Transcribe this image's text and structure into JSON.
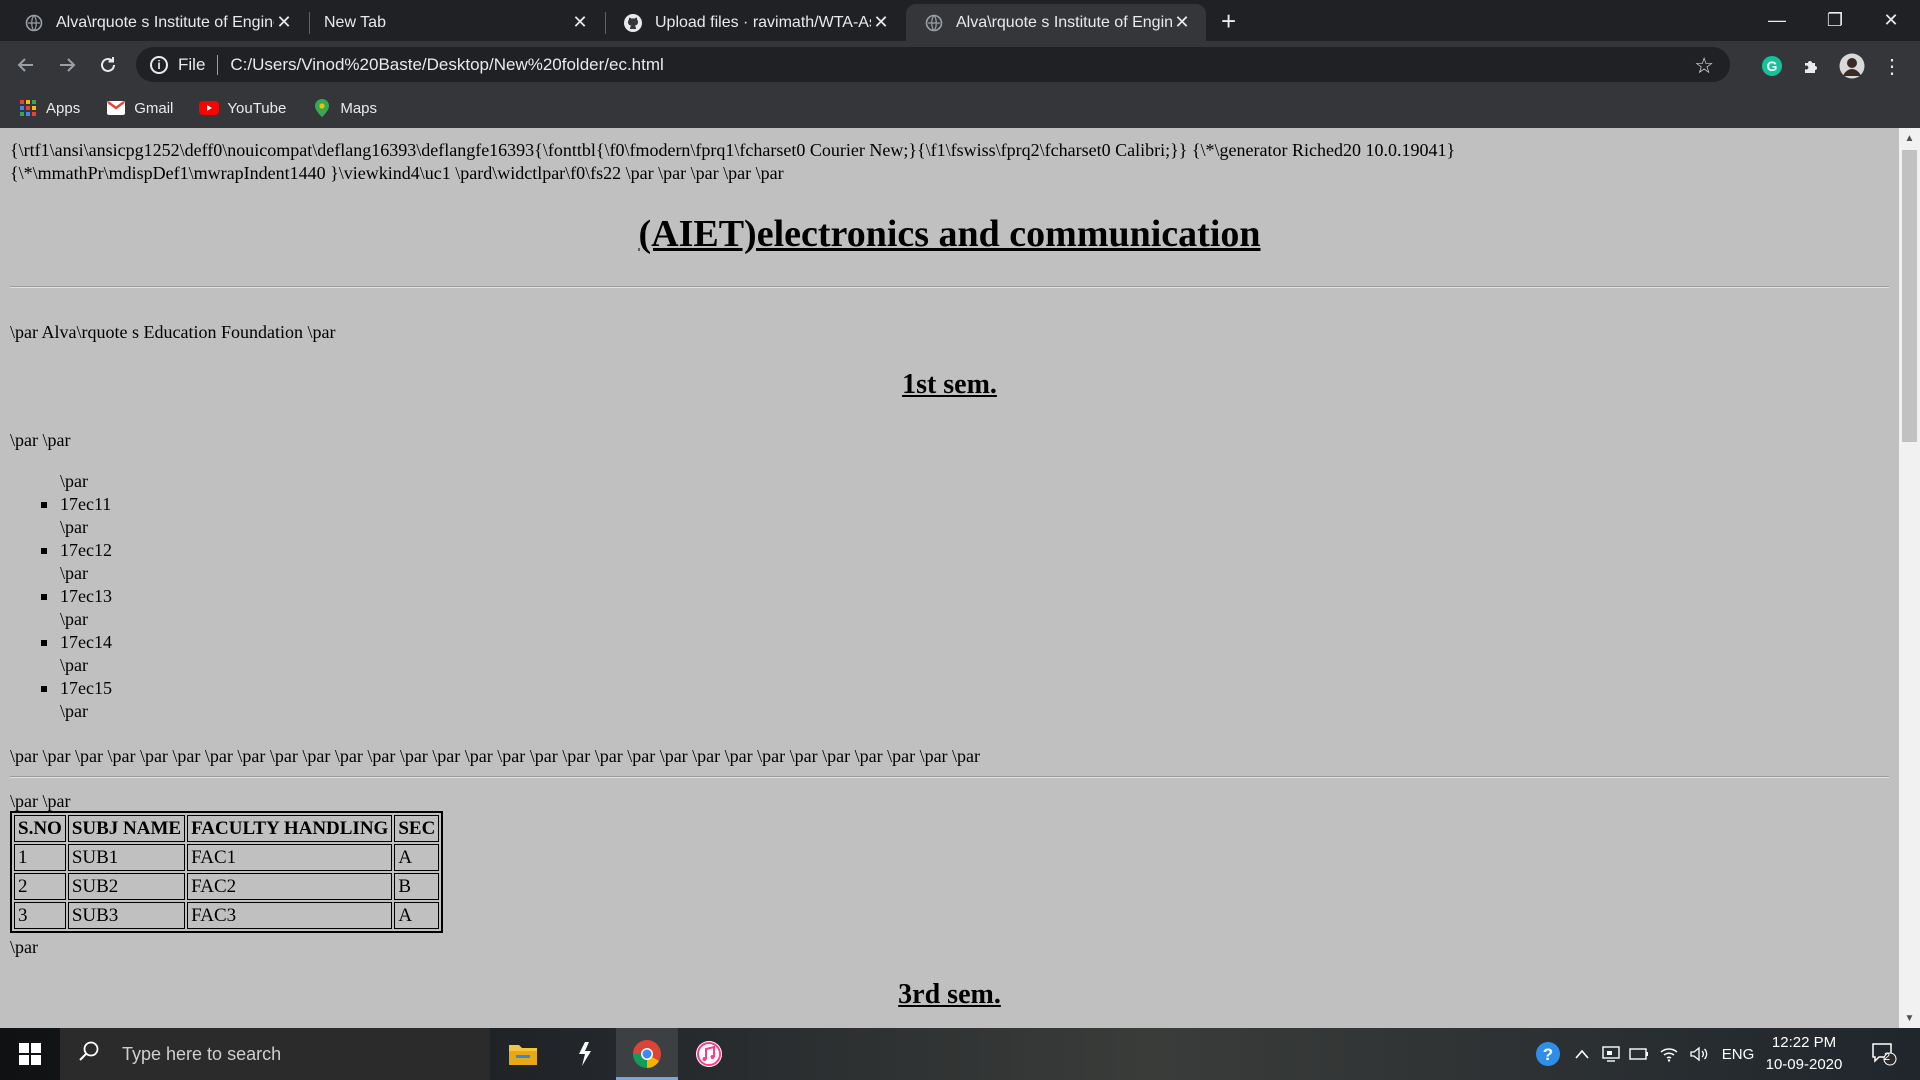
{
  "browser": {
    "tabs": [
      {
        "title": "Alva\\rquote s Institute of Enginee",
        "active": false
      },
      {
        "title": "New Tab",
        "active": false
      },
      {
        "title": "Upload files · ravimath/WTA-Assi",
        "active": false
      },
      {
        "title": "Alva\\rquote s Institute of Enginee",
        "active": true
      }
    ],
    "new_tab": "+",
    "window_controls": {
      "minimize": "—",
      "maximize": "❐",
      "close": "✕"
    },
    "address": {
      "scheme_label": "File",
      "url": "C:/Users/Vinod%20Baste/Desktop/New%20folder/ec.html"
    },
    "bookmarks": [
      {
        "label": "Apps",
        "icon": "apps-grid-icon"
      },
      {
        "label": "Gmail",
        "icon": "gmail-icon"
      },
      {
        "label": "YouTube",
        "icon": "youtube-icon"
      },
      {
        "label": "Maps",
        "icon": "maps-pin-icon"
      }
    ]
  },
  "page": {
    "rtf_header_line1": "{\\rtf1\\ansi\\ansicpg1252\\deff0\\nouicompat\\deflang16393\\deflangfe16393{\\fonttbl{\\f0\\fmodern\\fprq1\\fcharset0 Courier New;}{\\f1\\fswiss\\fprq2\\fcharset0 Calibri;}} {\\*\\generator Riched20 10.0.19041}",
    "rtf_header_line2": "{\\*\\mmathPr\\mdispDef1\\mwrapIndent1440 }\\viewkind4\\uc1 \\pard\\widctlpar\\f0\\fs22 \\par \\par \\par \\par \\par",
    "title": "(AIET)electronics and communication",
    "foundation": "\\par Alva\\rquote s Education Foundation \\par",
    "sem1_heading": "1st sem.",
    "par_par": "\\par \\par",
    "list_items": [
      {
        "text": "\\par",
        "bullet": false
      },
      {
        "text": "17ec11",
        "bullet": true
      },
      {
        "text": "\\par",
        "bullet": false
      },
      {
        "text": "17ec12",
        "bullet": true
      },
      {
        "text": "\\par",
        "bullet": false
      },
      {
        "text": "17ec13",
        "bullet": true
      },
      {
        "text": "\\par",
        "bullet": false
      },
      {
        "text": "17ec14",
        "bullet": true
      },
      {
        "text": "\\par",
        "bullet": false
      },
      {
        "text": "17ec15",
        "bullet": true
      },
      {
        "text": "\\par",
        "bullet": false
      }
    ],
    "par_run": "\\par \\par \\par \\par \\par \\par \\par \\par \\par \\par \\par \\par \\par \\par \\par \\par \\par \\par \\par \\par \\par \\par \\par \\par \\par \\par \\par \\par \\par \\par",
    "par_par_2": "\\par \\par",
    "table": {
      "headers": [
        "S.NO",
        "SUBJ NAME",
        "FACULTY HANDLING",
        "SEC"
      ],
      "rows": [
        [
          "1",
          "SUB1",
          "FAC1",
          "A"
        ],
        [
          "2",
          "SUB2",
          "FAC2",
          "B"
        ],
        [
          "3",
          "SUB3",
          "FAC3",
          "A"
        ]
      ]
    },
    "par_after_table": "\\par",
    "sem3_heading": "3rd sem."
  },
  "taskbar": {
    "search_placeholder": "Type here to search",
    "apps": [
      "file-explorer-icon",
      "sublime-text-icon",
      "chrome-icon",
      "itunes-icon"
    ],
    "tray": {
      "language": "ENG",
      "time": "12:22 PM",
      "date": "10-09-2020",
      "notifications": "2"
    }
  }
}
